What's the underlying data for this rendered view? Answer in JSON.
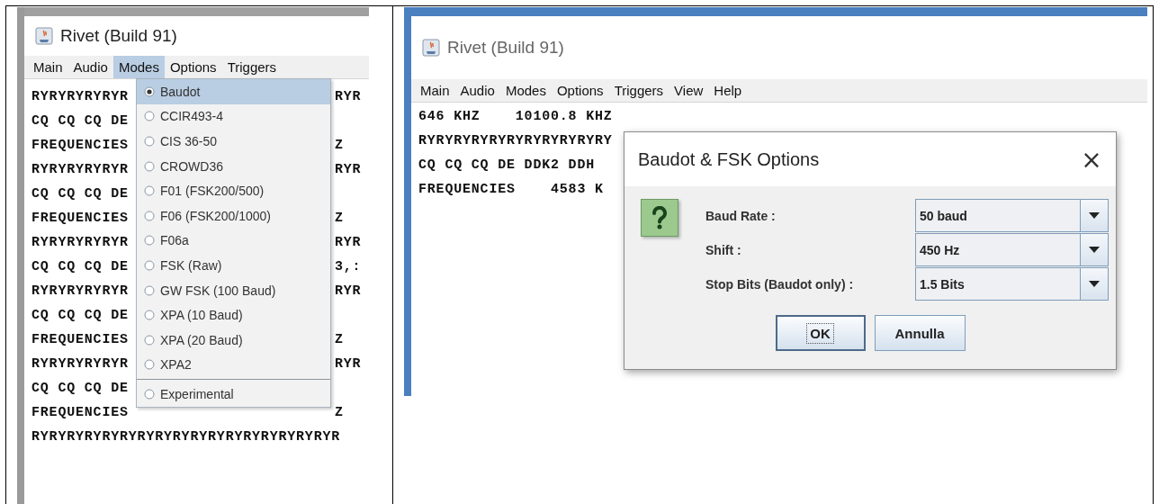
{
  "left_window": {
    "title": "Rivet (Build 91)",
    "menu_bar": [
      {
        "label": "Main",
        "selected": false
      },
      {
        "label": "Audio",
        "selected": false
      },
      {
        "label": "Modes",
        "selected": true
      },
      {
        "label": "Options",
        "selected": false
      },
      {
        "label": "Triggers",
        "selected": false
      }
    ],
    "output_lines": [
      {
        "left": "RYRYRYRYRYR",
        "right": "RYR"
      },
      {
        "left": "CQ CQ CQ DE"
      },
      {
        "left": "FREQUENCIES",
        "right": "Z"
      },
      {
        "left": "RYRYRYRYRYR",
        "right": "RYR"
      },
      {
        "left": "CQ CQ CQ DE"
      },
      {
        "left": "FREQUENCIES",
        "right": "Z"
      },
      {
        "left": "RYRYRYRYRYR",
        "right": "RYR"
      },
      {
        "left": "CQ CQ CQ DE",
        "right": "3,:"
      },
      {
        "left": "RYRYRYRYRYR",
        "right": "RYR"
      },
      {
        "left": "CQ CQ CQ DE"
      },
      {
        "left": "FREQUENCIES",
        "right": "Z"
      },
      {
        "left": "RYRYRYRYRYR",
        "right": "RYR"
      },
      {
        "left": "CQ CQ CQ DE"
      },
      {
        "left": "FREQUENCIES",
        "right": "Z"
      },
      {
        "left": "RYRYRYRYRYRYRYRYRYRYRYRYRYRYRYRYRYR"
      }
    ],
    "modes_menu": {
      "groups": [
        [
          {
            "label": "Baudot",
            "selected": true
          },
          {
            "label": "CCIR493-4",
            "selected": false
          },
          {
            "label": "CIS 36-50",
            "selected": false
          },
          {
            "label": "CROWD36",
            "selected": false
          },
          {
            "label": "F01 (FSK200/500)",
            "selected": false
          },
          {
            "label": "F06 (FSK200/1000)",
            "selected": false
          },
          {
            "label": "F06a",
            "selected": false
          },
          {
            "label": "FSK (Raw)",
            "selected": false
          },
          {
            "label": "GW FSK (100 Baud)",
            "selected": false
          },
          {
            "label": "XPA (10 Baud)",
            "selected": false
          },
          {
            "label": "XPA (20 Baud)",
            "selected": false
          },
          {
            "label": "XPA2",
            "selected": false
          }
        ],
        [
          {
            "label": "Experimental",
            "selected": false
          }
        ]
      ]
    }
  },
  "right_window": {
    "title": "Rivet (Build 91)",
    "menu_bar": [
      {
        "label": "Main",
        "selected": false
      },
      {
        "label": "Audio",
        "selected": false
      },
      {
        "label": "Modes",
        "selected": false
      },
      {
        "label": "Options",
        "selected": false
      },
      {
        "label": "Triggers",
        "selected": false
      },
      {
        "label": "View",
        "selected": false
      },
      {
        "label": "Help",
        "selected": false
      }
    ],
    "output_lines": [
      {
        "left": "646 KHZ    10100.8 KHZ"
      },
      {
        "left": "RYRYRYRYRYRYRYRYRYRYRY"
      },
      {
        "left": "CQ CQ CQ DE DDK2 DDH"
      },
      {
        "left": "FREQUENCIES    4583 K"
      }
    ],
    "dialog": {
      "title": "Baudot & FSK Options",
      "close": "×",
      "fields": [
        {
          "label": "Baud Rate :",
          "value": "50 baud"
        },
        {
          "label": "Shift :",
          "value": "450 Hz"
        },
        {
          "label": "Stop Bits (Baudot only) :",
          "value": "1.5 Bits"
        }
      ],
      "buttons": [
        {
          "label": "OK",
          "focused": true
        },
        {
          "label": "Annulla",
          "focused": false
        }
      ]
    }
  }
}
